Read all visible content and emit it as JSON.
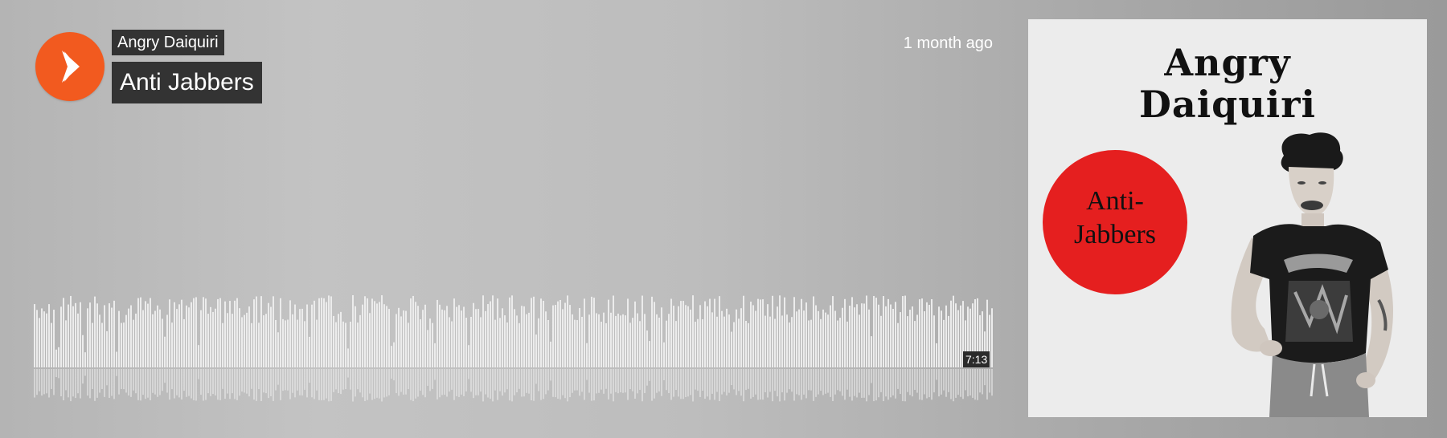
{
  "player": {
    "artist": "Angry Daiquiri",
    "title": "Anti Jabbers",
    "posted": "1 month ago",
    "duration": "7:13"
  },
  "artwork": {
    "artist_text": "Angry\nDaiquiri",
    "title_text": "Anti-\nJabbers",
    "circle_color": "#e51f1f",
    "background_color": "#ececec"
  },
  "colors": {
    "accent": "#f25a1f",
    "tag_background": "#333333",
    "waveform": "#ececec"
  },
  "icons": {
    "play": "play-icon"
  }
}
